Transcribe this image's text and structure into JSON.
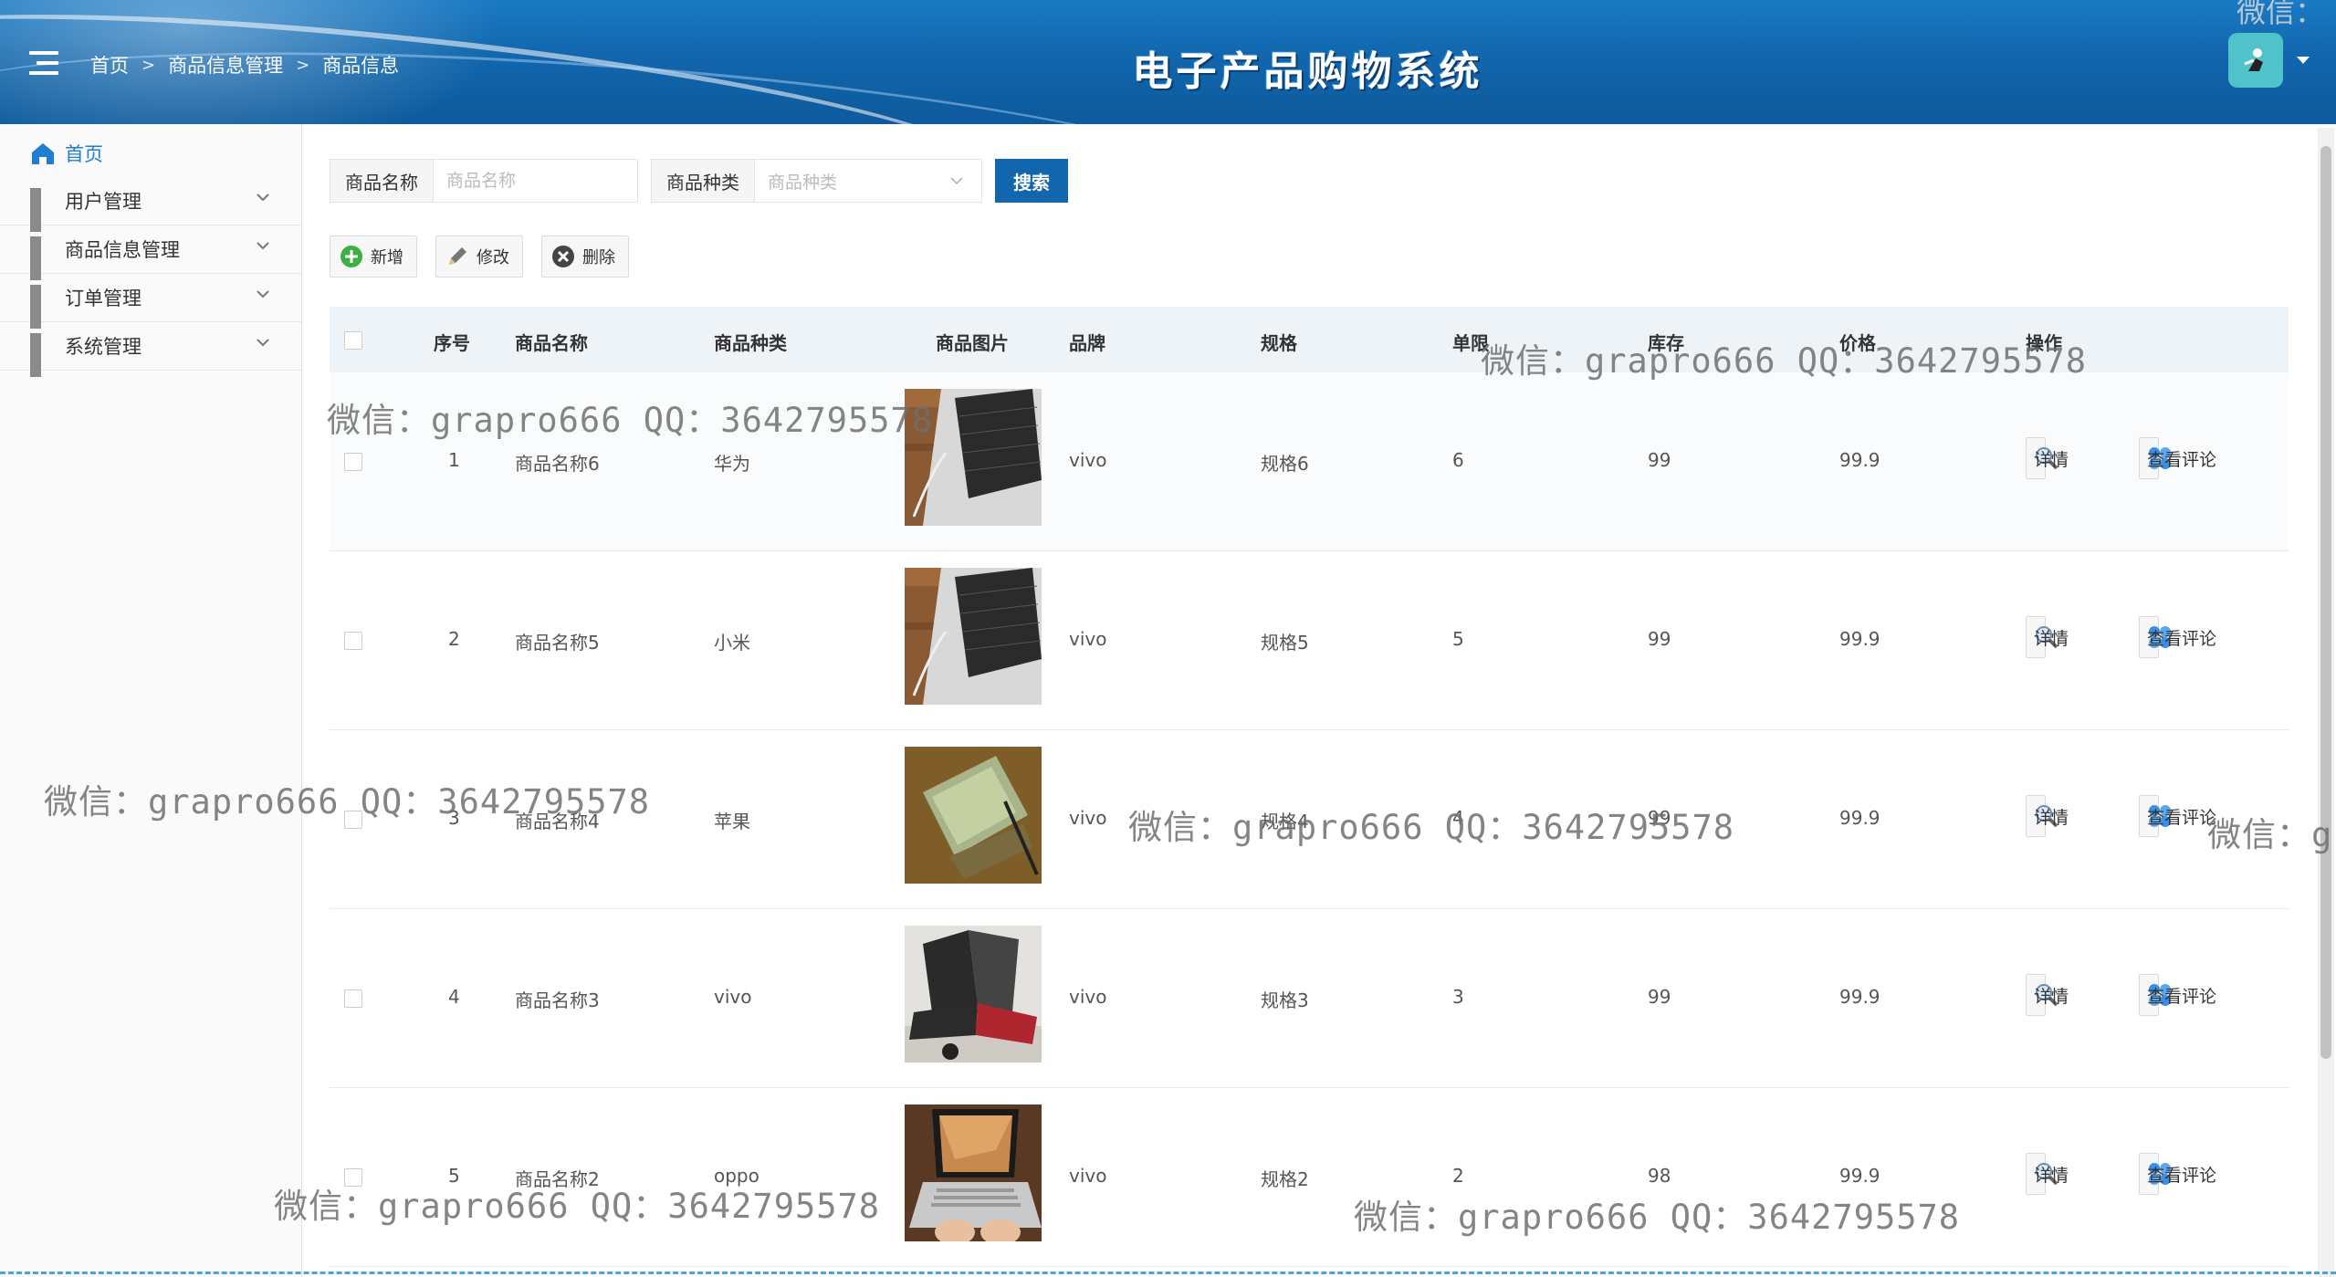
{
  "header": {
    "breadcrumb": [
      "首页",
      "商品信息管理",
      "商品信息"
    ],
    "system_title": "电子产品购物系统",
    "watermark_top": "微信："
  },
  "sidebar": {
    "items": [
      {
        "label": "首页",
        "icon": "home-icon"
      },
      {
        "label": "用户管理",
        "icon": "grid-icon"
      },
      {
        "label": "商品信息管理",
        "icon": "grid-icon"
      },
      {
        "label": "订单管理",
        "icon": "grid-icon"
      },
      {
        "label": "系统管理",
        "icon": "grid-icon"
      }
    ]
  },
  "search": {
    "name_label": "商品名称",
    "name_placeholder": "商品名称",
    "category_label": "商品种类",
    "category_placeholder": "商品种类",
    "button": "搜索"
  },
  "toolbar": {
    "add": "新增",
    "edit": "修改",
    "delete": "删除"
  },
  "table": {
    "headers": [
      "序号",
      "商品名称",
      "商品种类",
      "商品图片",
      "品牌",
      "规格",
      "单限",
      "库存",
      "价格",
      "操作"
    ],
    "rows": [
      {
        "no": "1",
        "name": "商品名称6",
        "category": "华为",
        "brand": "vivo",
        "spec": "规格6",
        "limit": "6",
        "stock": "99",
        "price": "99.9"
      },
      {
        "no": "2",
        "name": "商品名称5",
        "category": "小米",
        "brand": "vivo",
        "spec": "规格5",
        "limit": "5",
        "stock": "99",
        "price": "99.9"
      },
      {
        "no": "3",
        "name": "商品名称4",
        "category": "苹果",
        "brand": "vivo",
        "spec": "规格4",
        "limit": "4",
        "stock": "99",
        "price": "99.9"
      },
      {
        "no": "4",
        "name": "商品名称3",
        "category": "vivo",
        "brand": "vivo",
        "spec": "规格3",
        "limit": "3",
        "stock": "99",
        "price": "99.9"
      },
      {
        "no": "5",
        "name": "商品名称2",
        "category": "oppo",
        "brand": "vivo",
        "spec": "规格2",
        "limit": "2",
        "stock": "98",
        "price": "99.9"
      }
    ],
    "detail_button": "详情",
    "comment_button": "查看评论"
  },
  "watermarks": {
    "text": "微信：grapro666 QQ：3642795578",
    "edge_text": "微信：g"
  },
  "colors": {
    "header_blue": "#1266ad",
    "accent_blue": "#1e7fd0",
    "avatar_teal": "#4fc3c9",
    "add_green": "#3cb043"
  }
}
